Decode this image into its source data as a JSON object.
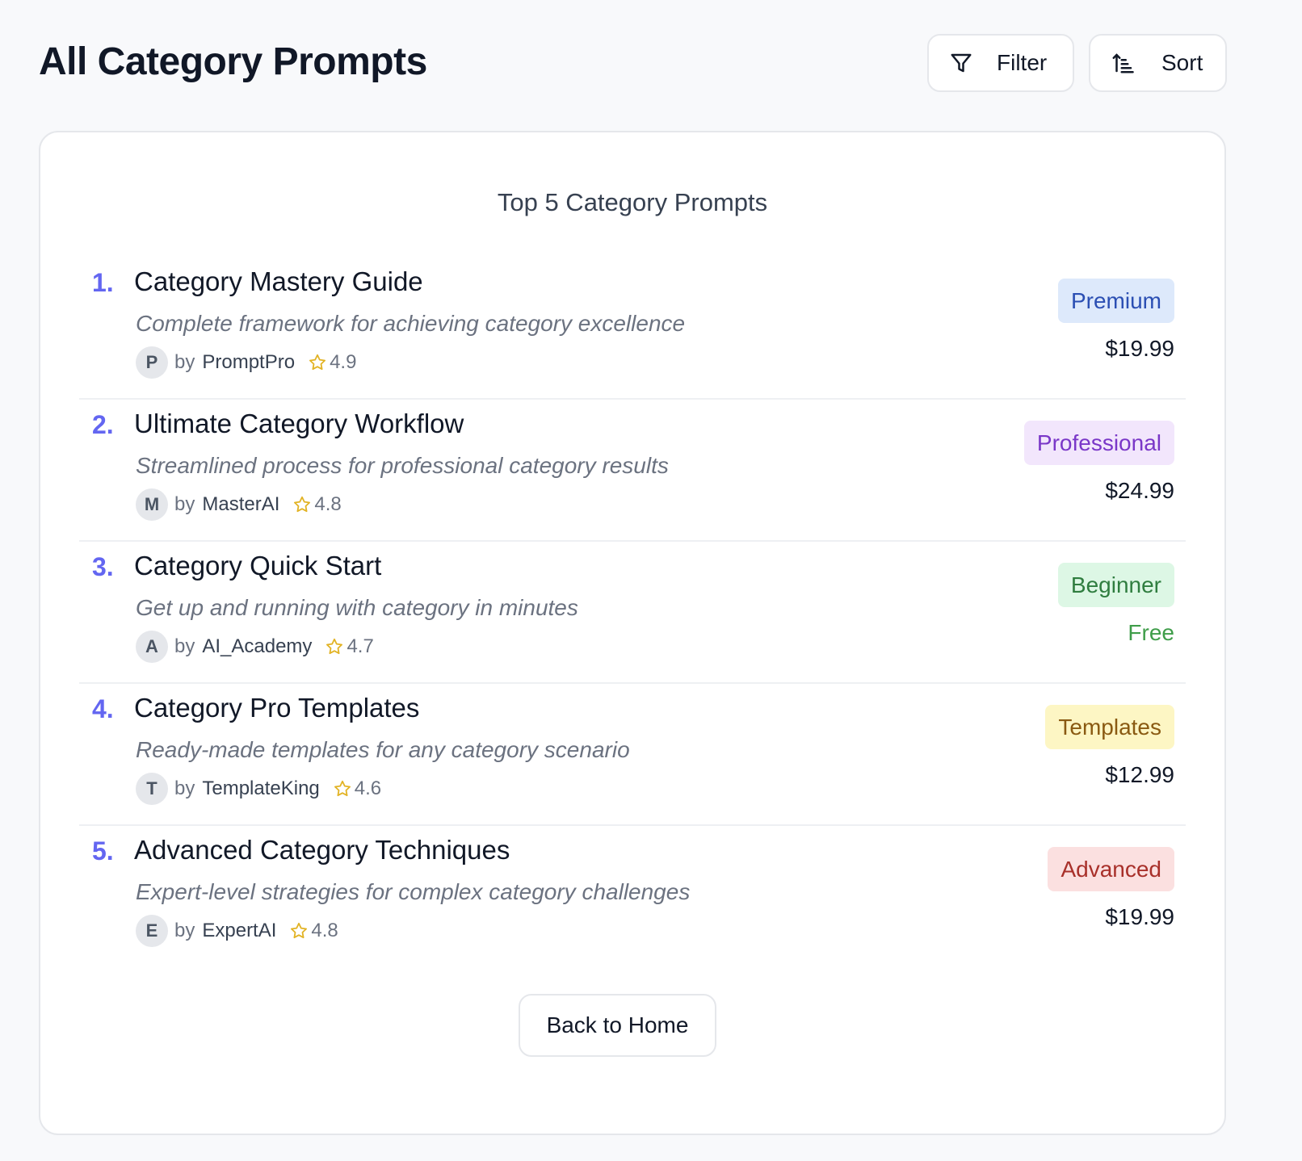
{
  "header": {
    "title": "All Category Prompts",
    "filter_label": "Filter",
    "filter_icon": "filter-icon",
    "sort_label": "Sort",
    "sort_icon": "sort-ascending-icon"
  },
  "card": {
    "title": "Top 5 Category Prompts",
    "back_button_label": "Back to Home"
  },
  "prompts": [
    {
      "rank": "1.",
      "title": "Category Mastery Guide",
      "description": "Complete framework for achieving category excellence",
      "avatar_initial": "P",
      "by_label": "by",
      "author": "PromptPro",
      "rating": "4.9",
      "badge": "Premium",
      "badge_bg": "#dde9fb",
      "badge_color": "#2b4fb3",
      "price": "$19.99",
      "price_color": "#111827"
    },
    {
      "rank": "2.",
      "title": "Ultimate Category Workflow",
      "description": "Streamlined process for professional category results",
      "avatar_initial": "M",
      "by_label": "by",
      "author": "MasterAI",
      "rating": "4.8",
      "badge": "Professional",
      "badge_bg": "#f2e6fc",
      "badge_color": "#7a37c8",
      "price": "$24.99",
      "price_color": "#111827"
    },
    {
      "rank": "3.",
      "title": "Category Quick Start",
      "description": "Get up and running with category in minutes",
      "avatar_initial": "A",
      "by_label": "by",
      "author": "AI_Academy",
      "rating": "4.7",
      "badge": "Beginner",
      "badge_bg": "#ddf7e5",
      "badge_color": "#2f7d3f",
      "price": "Free",
      "price_color": "#3f9d4a"
    },
    {
      "rank": "4.",
      "title": "Category Pro Templates",
      "description": "Ready-made templates for any category scenario",
      "avatar_initial": "T",
      "by_label": "by",
      "author": "TemplateKing",
      "rating": "4.6",
      "badge": "Templates",
      "badge_bg": "#fdf6c4",
      "badge_color": "#8a5a12",
      "price": "$12.99",
      "price_color": "#111827"
    },
    {
      "rank": "5.",
      "title": "Advanced Category Techniques",
      "description": "Expert-level strategies for complex category challenges",
      "avatar_initial": "E",
      "by_label": "by",
      "author": "ExpertAI",
      "rating": "4.8",
      "badge": "Advanced",
      "badge_bg": "#fbe0e0",
      "badge_color": "#a8302a",
      "price": "$19.99",
      "price_color": "#111827"
    }
  ],
  "colors": {
    "page_bg": "#f8f9fb",
    "rank_accent": "#6366f1",
    "star": "#e2b325"
  },
  "icons": {
    "star": "star-outline-icon"
  }
}
